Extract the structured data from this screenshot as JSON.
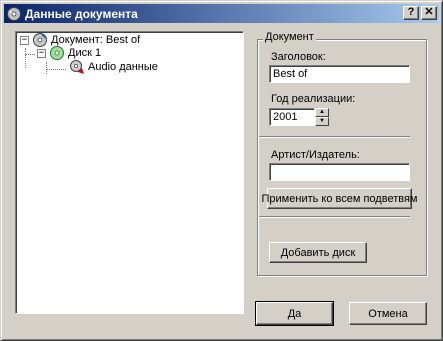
{
  "window": {
    "title": "Данные документа",
    "help_label": "?",
    "close_label": "✕"
  },
  "tree": {
    "root_label": "Документ: Best of",
    "disc_label": "Диск 1",
    "audio_label": "Audio данные"
  },
  "document": {
    "group_title": "Документ",
    "title_label": "Заголовок:",
    "title_value": "Best of",
    "year_label": "Год реализации:",
    "year_value": "2001",
    "artist_label": "Артист/Издатель:",
    "artist_value": "",
    "apply_all_label": "Применить ко всем подветвям",
    "add_disc_label": "Добавить диск"
  },
  "buttons": {
    "ok_label": "Да",
    "cancel_label": "Отмена"
  },
  "colors": {
    "title_gradient_start": "#0a246a",
    "title_gradient_end": "#a6caf0",
    "dialog_bg": "#d4d0c8"
  }
}
